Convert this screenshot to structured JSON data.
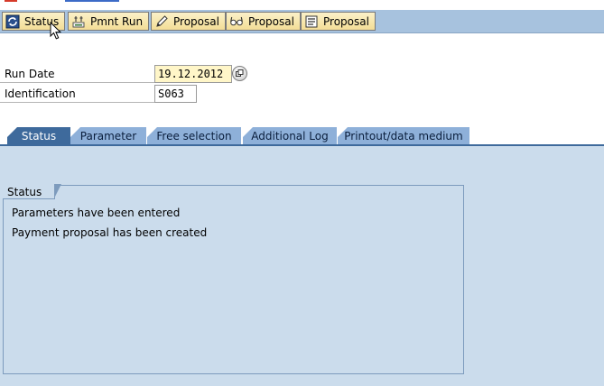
{
  "toolbar": {
    "buttons": [
      {
        "label": "Status",
        "icon": "status-icon"
      },
      {
        "label": "Pmnt Run",
        "icon": "payment-run-icon"
      },
      {
        "label": "Proposal",
        "icon": "pencil-icon"
      },
      {
        "label": "Proposal",
        "icon": "glasses-icon"
      },
      {
        "label": "Proposal",
        "icon": "list-icon"
      }
    ]
  },
  "form": {
    "run_date": {
      "label": "Run Date",
      "value": "19.12.2012"
    },
    "identification": {
      "label": "Identification",
      "value": "S063"
    }
  },
  "tabs": [
    {
      "label": "Status",
      "active": true
    },
    {
      "label": "Parameter",
      "active": false
    },
    {
      "label": "Free selection",
      "active": false
    },
    {
      "label": "Additional Log",
      "active": false
    },
    {
      "label": "Printout/data medium",
      "active": false
    }
  ],
  "status_group": {
    "title": "Status",
    "messages": [
      "Parameters have been entered",
      "Payment proposal has been created"
    ]
  },
  "colors": {
    "toolbar_bg": "#a7c2de",
    "button_bg": "#f3dd96",
    "tab_active": "#3e6a9c",
    "tab_inactive": "#8eb0d9",
    "panel_bg": "#cbdcec",
    "required_field_bg": "#fff6c8"
  }
}
